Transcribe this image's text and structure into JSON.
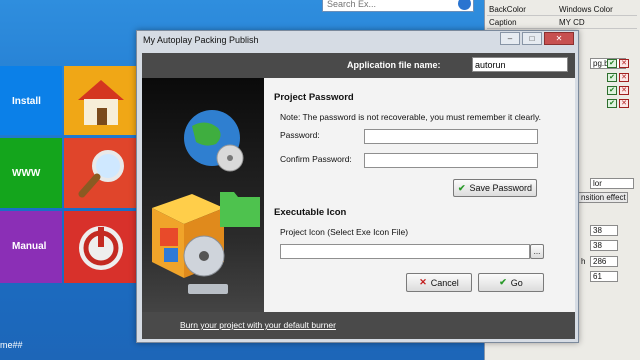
{
  "background": {
    "tiles": {
      "install": "Install",
      "www": "WWW",
      "manual": "Manual"
    },
    "tile_name_fragment": "me##",
    "search_placeholder": "Search Ex...",
    "properties": [
      {
        "key": "BackColor",
        "value": "Windows Color"
      },
      {
        "key": "Caption",
        "value": "MY CD"
      }
    ],
    "side_cells": [
      "pg.bm",
      "lor",
      "nsition effect"
    ],
    "numbers": [
      "38",
      "38",
      "286",
      "61"
    ],
    "num_label_fragment": "h"
  },
  "dialog": {
    "title": "My Autoplay Packing Publish",
    "window_buttons": {
      "minimize": "–",
      "maximize": "□",
      "close": "✕"
    },
    "app_file_label": "Application file name:",
    "app_file_value": "autorun",
    "password_section": "Project Password",
    "password_note": "Note: The password is not recoverable, you must remember it clearly.",
    "password_label": "Password:",
    "confirm_label": "Confirm Password:",
    "save_password": "Save Password",
    "icon_section": "Executable Icon",
    "icon_label": "Project Icon (Select Exe Icon File)",
    "browse": "...",
    "cancel": "Cancel",
    "go": "Go",
    "burn_link": "Burn your project with your default burner"
  },
  "icons": [
    "home-icon",
    "magnifier-icon",
    "power-icon",
    "check-icon",
    "x-icon",
    "globe-icon",
    "box-icon",
    "folder-icon"
  ]
}
